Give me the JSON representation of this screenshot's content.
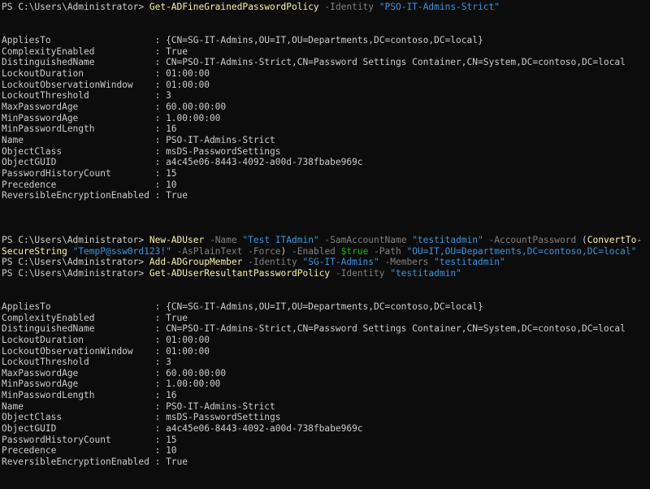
{
  "colors": {
    "background": "#0c0c0c",
    "default_text": "#cccccc",
    "command": "#f9f1a5",
    "parameter": "#808080",
    "string": "#3a96dd",
    "variable": "#00c200"
  },
  "terminal": {
    "lines": [
      {
        "row": 0,
        "segments": [
          {
            "t": "PS C:\\Users\\Administrator> ",
            "c": "default_text"
          },
          {
            "t": "Get-ADFineGrainedPasswordPolicy",
            "c": "command"
          },
          {
            "t": " -Identity ",
            "c": "parameter"
          },
          {
            "t": "\"PSO-IT-Admins-Strict\"",
            "c": "string"
          }
        ]
      },
      {
        "row": 3,
        "segments": [
          {
            "t": "AppliesTo                   : {CN=SG-IT-Admins,OU=IT,OU=Departments,DC=contoso,DC=local}",
            "c": "default_text"
          }
        ]
      },
      {
        "row": 4,
        "segments": [
          {
            "t": "ComplexityEnabled           : True",
            "c": "default_text"
          }
        ]
      },
      {
        "row": 5,
        "segments": [
          {
            "t": "DistinguishedName           : CN=PSO-IT-Admins-Strict,CN=Password Settings Container,CN=System,DC=contoso,DC=local",
            "c": "default_text"
          }
        ]
      },
      {
        "row": 6,
        "segments": [
          {
            "t": "LockoutDuration             : 01:00:00",
            "c": "default_text"
          }
        ]
      },
      {
        "row": 7,
        "segments": [
          {
            "t": "LockoutObservationWindow    : 01:00:00",
            "c": "default_text"
          }
        ]
      },
      {
        "row": 8,
        "segments": [
          {
            "t": "LockoutThreshold            : 3",
            "c": "default_text"
          }
        ]
      },
      {
        "row": 9,
        "segments": [
          {
            "t": "MaxPasswordAge              : 60.00:00:00",
            "c": "default_text"
          }
        ]
      },
      {
        "row": 10,
        "segments": [
          {
            "t": "MinPasswordAge              : 1.00:00:00",
            "c": "default_text"
          }
        ]
      },
      {
        "row": 11,
        "segments": [
          {
            "t": "MinPasswordLength           : 16",
            "c": "default_text"
          }
        ]
      },
      {
        "row": 12,
        "segments": [
          {
            "t": "Name                        : PSO-IT-Admins-Strict",
            "c": "default_text"
          }
        ]
      },
      {
        "row": 13,
        "segments": [
          {
            "t": "ObjectClass                 : msDS-PasswordSettings",
            "c": "default_text"
          }
        ]
      },
      {
        "row": 14,
        "segments": [
          {
            "t": "ObjectGUID                  : a4c45e06-8443-4092-a00d-738fbabe969c",
            "c": "default_text"
          }
        ]
      },
      {
        "row": 15,
        "segments": [
          {
            "t": "PasswordHistoryCount        : 15",
            "c": "default_text"
          }
        ]
      },
      {
        "row": 16,
        "segments": [
          {
            "t": "Precedence                  : 10",
            "c": "default_text"
          }
        ]
      },
      {
        "row": 17,
        "segments": [
          {
            "t": "ReversibleEncryptionEnabled : True",
            "c": "default_text"
          }
        ]
      },
      {
        "row": 21,
        "segments": [
          {
            "t": "PS C:\\Users\\Administrator> ",
            "c": "default_text"
          },
          {
            "t": "New-ADUser",
            "c": "command"
          },
          {
            "t": " -Name ",
            "c": "parameter"
          },
          {
            "t": "\"Test ITAdmin\"",
            "c": "string"
          },
          {
            "t": " -SamAccountName ",
            "c": "parameter"
          },
          {
            "t": "\"testitadmin\"",
            "c": "string"
          },
          {
            "t": " -AccountPassword ",
            "c": "parameter"
          },
          {
            "t": "(",
            "c": "default_text"
          },
          {
            "t": "ConvertTo-",
            "c": "command"
          }
        ]
      },
      {
        "row": 22,
        "segments": [
          {
            "t": "SecureString",
            "c": "command"
          },
          {
            "t": " ",
            "c": "default_text"
          },
          {
            "t": "\"TempP@ssw0rd123!\"",
            "c": "string"
          },
          {
            "t": " -AsPlainText -Force",
            "c": "parameter"
          },
          {
            "t": ") ",
            "c": "default_text"
          },
          {
            "t": "-Enabled ",
            "c": "parameter"
          },
          {
            "t": "$true",
            "c": "variable"
          },
          {
            "t": " -Path ",
            "c": "parameter"
          },
          {
            "t": "\"OU=IT,OU=Departments,DC=contoso,DC=local\"",
            "c": "string"
          }
        ]
      },
      {
        "row": 23,
        "segments": [
          {
            "t": "PS C:\\Users\\Administrator> ",
            "c": "default_text"
          },
          {
            "t": "Add-ADGroupMember",
            "c": "command"
          },
          {
            "t": " -Identity ",
            "c": "parameter"
          },
          {
            "t": "\"SG-IT-Admins\"",
            "c": "string"
          },
          {
            "t": " -Members ",
            "c": "parameter"
          },
          {
            "t": "\"testitadmin\"",
            "c": "string"
          }
        ]
      },
      {
        "row": 24,
        "segments": [
          {
            "t": "PS C:\\Users\\Administrator> ",
            "c": "default_text"
          },
          {
            "t": "Get-ADUserResultantPasswordPolicy",
            "c": "command"
          },
          {
            "t": " -Identity ",
            "c": "parameter"
          },
          {
            "t": "\"testitadmin\"",
            "c": "string"
          }
        ]
      },
      {
        "row": 27,
        "segments": [
          {
            "t": "AppliesTo                   : {CN=SG-IT-Admins,OU=IT,OU=Departments,DC=contoso,DC=local}",
            "c": "default_text"
          }
        ]
      },
      {
        "row": 28,
        "segments": [
          {
            "t": "ComplexityEnabled           : True",
            "c": "default_text"
          }
        ]
      },
      {
        "row": 29,
        "segments": [
          {
            "t": "DistinguishedName           : CN=PSO-IT-Admins-Strict,CN=Password Settings Container,CN=System,DC=contoso,DC=local",
            "c": "default_text"
          }
        ]
      },
      {
        "row": 30,
        "segments": [
          {
            "t": "LockoutDuration             : 01:00:00",
            "c": "default_text"
          }
        ]
      },
      {
        "row": 31,
        "segments": [
          {
            "t": "LockoutObservationWindow    : 01:00:00",
            "c": "default_text"
          }
        ]
      },
      {
        "row": 32,
        "segments": [
          {
            "t": "LockoutThreshold            : 3",
            "c": "default_text"
          }
        ]
      },
      {
        "row": 33,
        "segments": [
          {
            "t": "MaxPasswordAge              : 60.00:00:00",
            "c": "default_text"
          }
        ]
      },
      {
        "row": 34,
        "segments": [
          {
            "t": "MinPasswordAge              : 1.00:00:00",
            "c": "default_text"
          }
        ]
      },
      {
        "row": 35,
        "segments": [
          {
            "t": "MinPasswordLength           : 16",
            "c": "default_text"
          }
        ]
      },
      {
        "row": 36,
        "segments": [
          {
            "t": "Name                        : PSO-IT-Admins-Strict",
            "c": "default_text"
          }
        ]
      },
      {
        "row": 37,
        "segments": [
          {
            "t": "ObjectClass                 : msDS-PasswordSettings",
            "c": "default_text"
          }
        ]
      },
      {
        "row": 38,
        "segments": [
          {
            "t": "ObjectGUID                  : a4c45e06-8443-4092-a00d-738fbabe969c",
            "c": "default_text"
          }
        ]
      },
      {
        "row": 39,
        "segments": [
          {
            "t": "PasswordHistoryCount        : 15",
            "c": "default_text"
          }
        ]
      },
      {
        "row": 40,
        "segments": [
          {
            "t": "Precedence                  : 10",
            "c": "default_text"
          }
        ]
      },
      {
        "row": 41,
        "segments": [
          {
            "t": "ReversibleEncryptionEnabled : True",
            "c": "default_text"
          }
        ]
      }
    ]
  }
}
